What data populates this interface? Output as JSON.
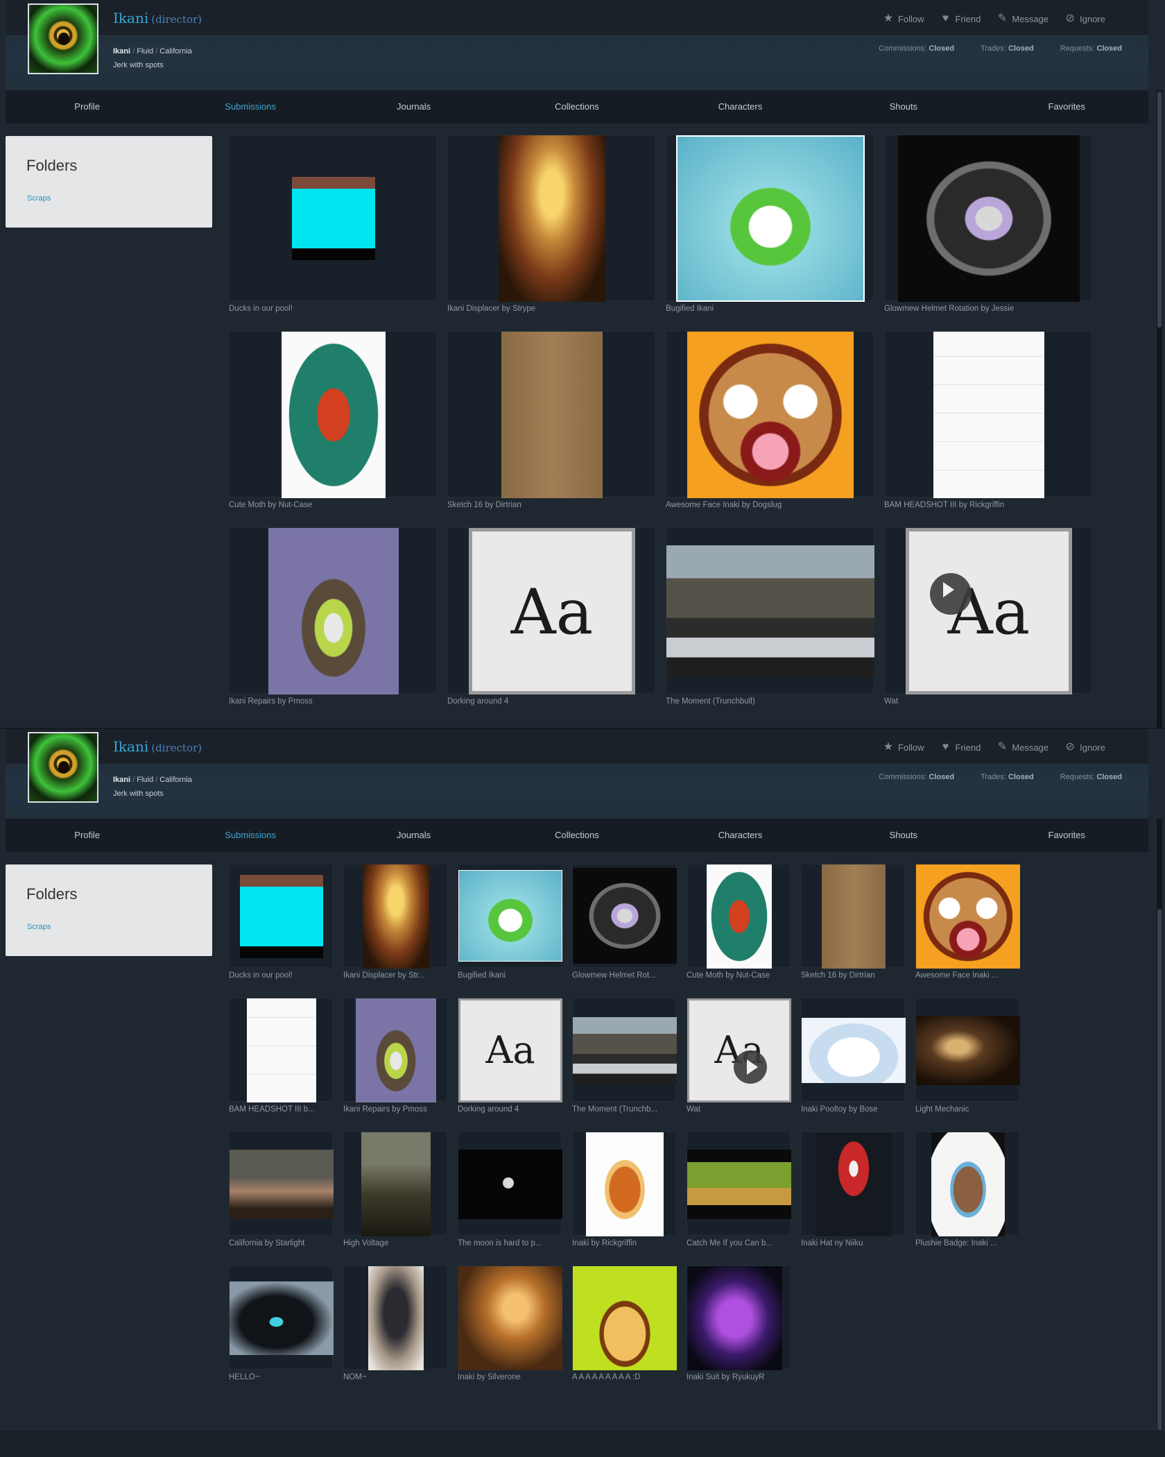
{
  "profile": {
    "username": "Ikani",
    "role": "(director)",
    "species": "Ikani",
    "gender": "Fluid",
    "location": "California",
    "tagline": "Jerk with spots"
  },
  "actions": [
    "Follow",
    "Friend",
    "Message",
    "Ignore"
  ],
  "action_icons": [
    "star-icon",
    "heart-icon",
    "pencil-icon",
    "ban-icon"
  ],
  "status": {
    "commissions_label": "Commissions:",
    "commissions_value": "Closed",
    "trades_label": "Trades:",
    "trades_value": "Closed",
    "requests_label": "Requests:",
    "requests_value": "Closed"
  },
  "nav": {
    "active": "Submissions",
    "tabs": [
      "Profile",
      "Submissions",
      "Journals",
      "Collections",
      "Characters",
      "Shouts",
      "Favorites"
    ]
  },
  "folders": {
    "title": "Folders",
    "link": "Scraps"
  },
  "large_grid": [
    "Ducks in our pool!",
    "Ikani Displacer by Strype",
    "Bugified Ikani",
    "Glowmew Helmet Rotation by Jessie",
    "Cute Moth by Nut-Case",
    "Sketch 16 by Dirtrian",
    "Awesome Face Inaki by Dogslug",
    "BAM HEADSHOT III by Rickgriffin",
    "Ikani Repairs by Pmoss",
    "Dorking around 4",
    "The Moment (Trunchbull)",
    "Wat"
  ],
  "small_grid": [
    "Ducks in our pool!",
    "Ikani Displacer by Str...",
    "Bugified Ikani",
    "Glowmew Helmet Rot...",
    "Cute Moth by Nut-Case",
    "Sketch 16 by Dirtrian",
    "Awesome Face Inaki ...",
    "BAM HEADSHOT III b...",
    "Ikani Repairs by Pmoss",
    "Dorking around 4",
    "The Moment (Trunchb...",
    "Wat",
    "Inaki Pooltoy by Bose",
    "Light Mechanic",
    "California by Starlight",
    "High Voltage",
    "The moon is hard to p...",
    "Inaki by Rickgriffin",
    "Catch Me If you Can b...",
    "Inaki Hat ny Niiku",
    "Plushie Badge: Inaki ...",
    "HELLO~",
    "NOM~",
    "Inaki by Silverone",
    "A A A A A A A A A :D",
    "Inaki Suit by RyukuyR"
  ],
  "thumb_text": {
    "font_sample": "Aa"
  }
}
